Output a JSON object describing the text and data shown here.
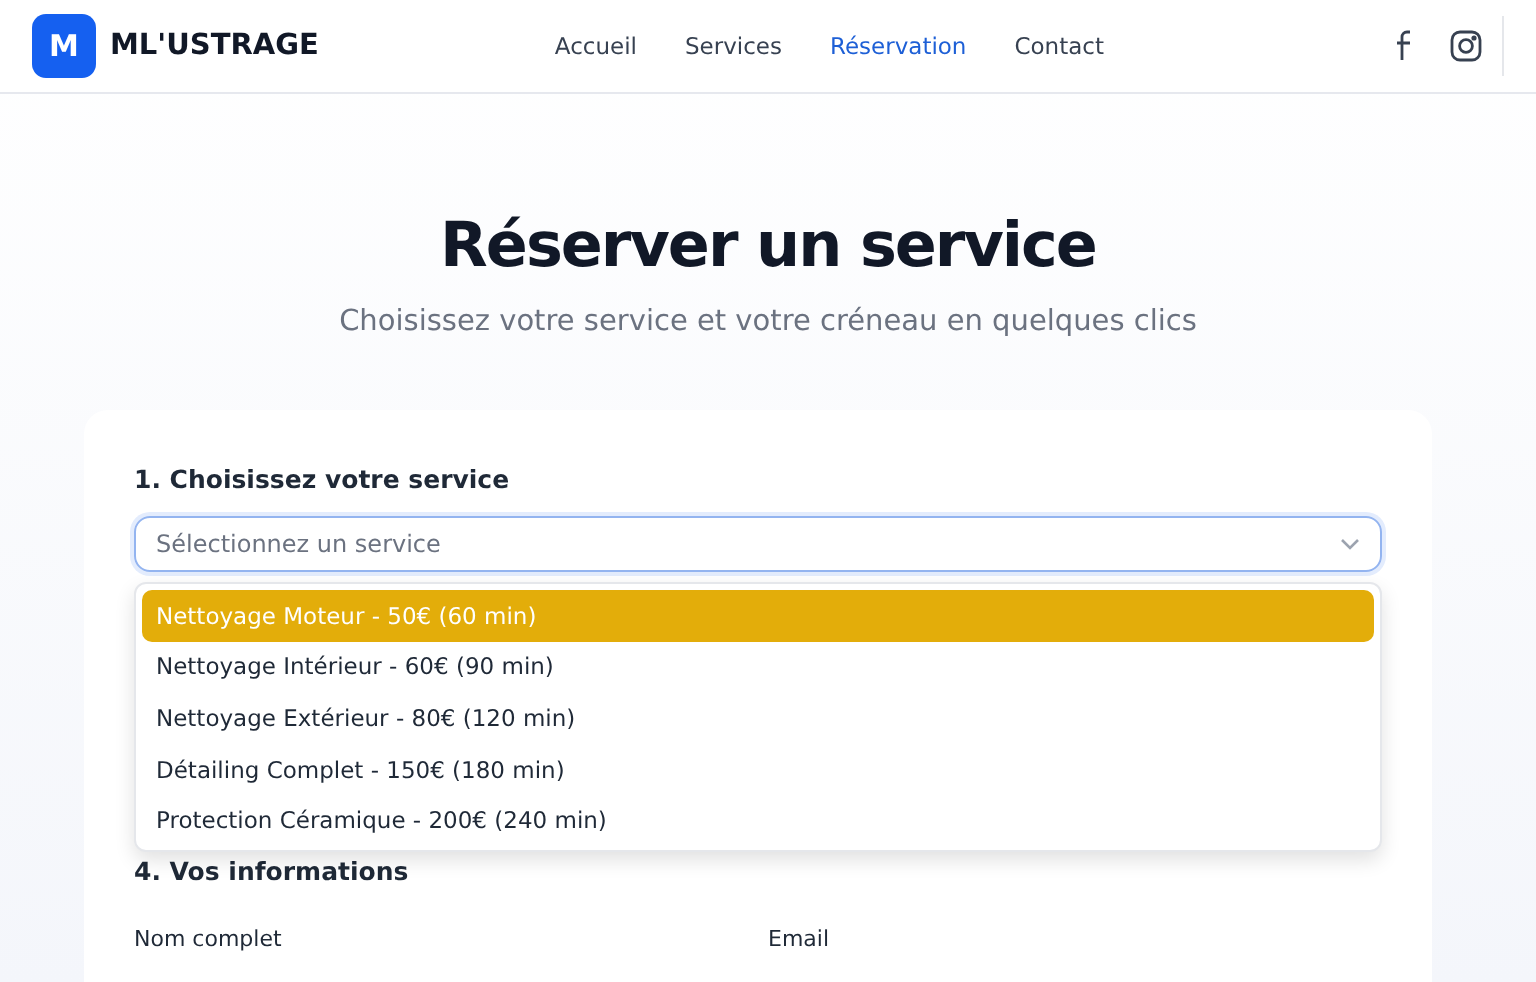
{
  "header": {
    "logo_letter": "M",
    "brand": "ML'USTRAGE",
    "nav": [
      {
        "label": "Accueil",
        "selected": false
      },
      {
        "label": "Services",
        "selected": false
      },
      {
        "label": "Réservation",
        "selected": true
      },
      {
        "label": "Contact",
        "selected": false
      }
    ]
  },
  "hero": {
    "title": "Réserver un service",
    "subtitle": "Choisissez votre service et votre créneau en quelques clics"
  },
  "form": {
    "step_1": "1. Choisissez votre service",
    "select": {
      "placeholder": "Sélectionnez un service",
      "expanded": true
    },
    "options": [
      {
        "label": "Nettoyage Moteur - 50€ (60 min)",
        "selected": true
      },
      {
        "label": "Nettoyage Intérieur - 60€ (90 min)",
        "selected": false
      },
      {
        "label": "Nettoyage Extérieur - 80€ (120 min)",
        "selected": false
      },
      {
        "label": "Détailing Complet - 150€ (180 min)",
        "selected": false
      },
      {
        "label": "Protection Céramique - 200€ (240 min)",
        "selected": false
      }
    ],
    "step_4": "4. Vos informations",
    "fields": [
      {
        "label": "Nom complet"
      },
      {
        "label": "Email"
      }
    ]
  }
}
